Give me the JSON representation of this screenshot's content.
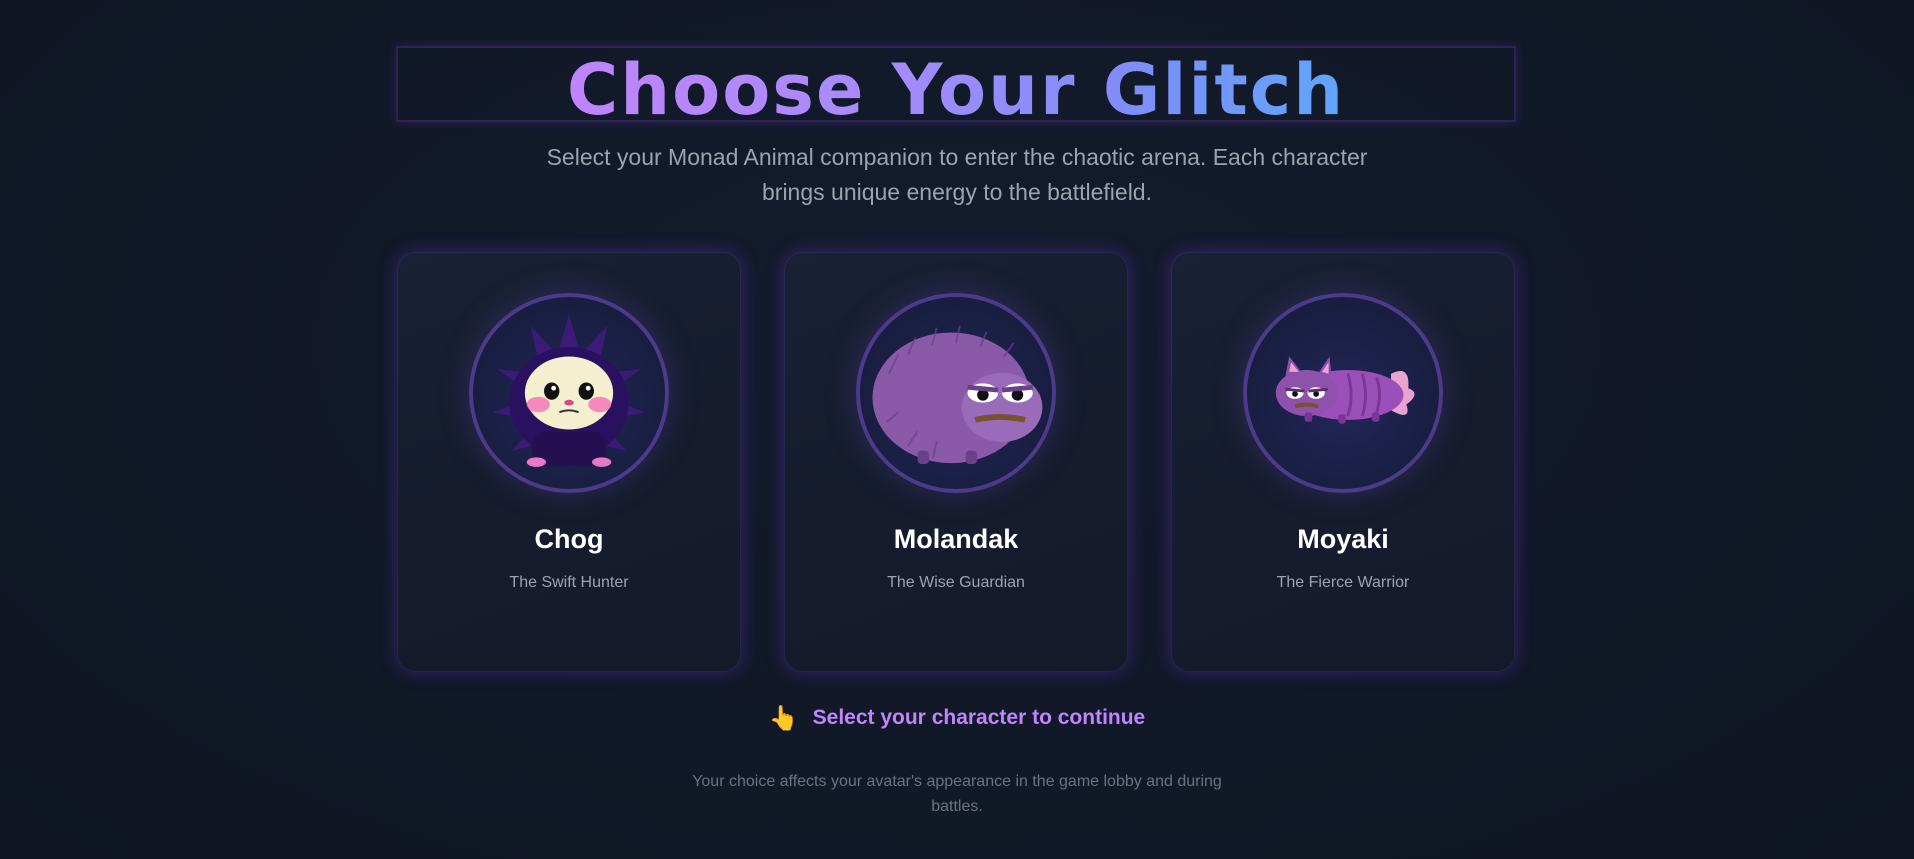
{
  "header": {
    "title": "Choose Your Glitch",
    "subtitle": "Select your Monad Animal companion to enter the chaotic arena. Each character brings unique energy to the battlefield."
  },
  "characters": [
    {
      "name": "Chog",
      "title": "The Swift Hunter",
      "icon": "hedgehog-avatar-icon"
    },
    {
      "name": "Molandak",
      "title": "The Wise Guardian",
      "icon": "porcupine-frog-avatar-icon"
    },
    {
      "name": "Moyaki",
      "title": "The Fierce Warrior",
      "icon": "cat-fish-avatar-icon"
    }
  ],
  "prompt": {
    "icon": "pointing-hand-icon",
    "glyph": "👆",
    "text": "Select your character to continue"
  },
  "footnote": "Your choice affects your avatar's appearance in the game lobby and during battles.",
  "colors": {
    "background": "#111827",
    "accent_purple": "#c084fc",
    "accent_blue": "#60a5fa",
    "ring": "#4c3a8a"
  }
}
